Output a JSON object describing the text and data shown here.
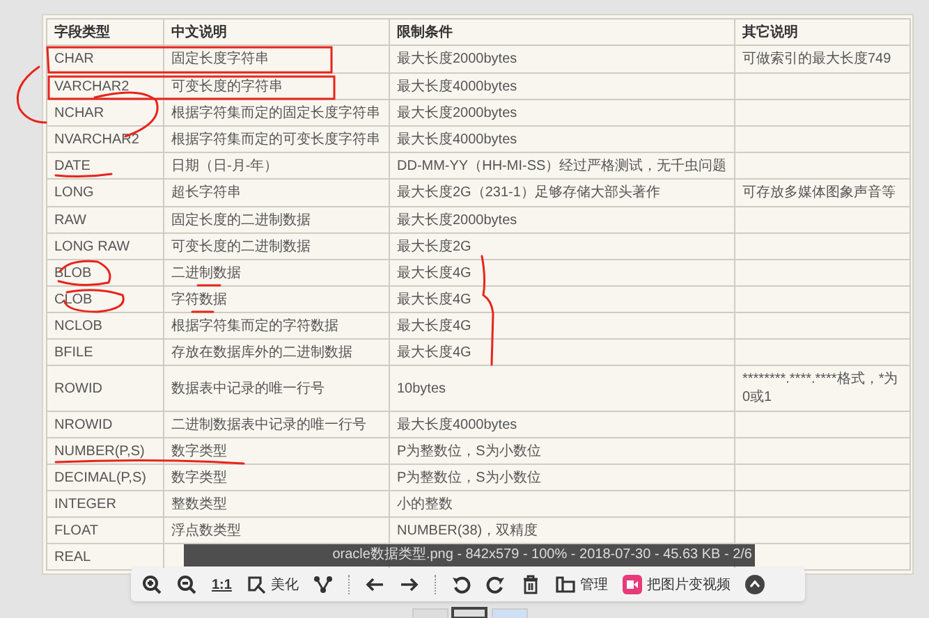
{
  "table": {
    "columns": [
      "字段类型",
      "中文说明",
      "限制条件",
      "其它说明"
    ],
    "rows": [
      {
        "field_type": "CHAR",
        "description": "固定长度字符串",
        "constraint": "最大长度2000bytes",
        "note": "可做索引的最大长度749"
      },
      {
        "field_type": "VARCHAR2",
        "description": "可变长度的字符串",
        "constraint": "最大长度4000bytes"
      },
      {
        "field_type": "NCHAR",
        "description": "根据字符集而定的固定长度字符串",
        "constraint": "最大长度2000bytes"
      },
      {
        "field_type": "NVARCHAR2",
        "description": "根据字符集而定的可变长度字符串",
        "constraint": "最大长度4000bytes"
      },
      {
        "field_type": "DATE",
        "description": "日期（日-月-年）",
        "constraint": "DD-MM-YY（HH-MI-SS）经过严格测试，无千虫问题"
      },
      {
        "field_type": "LONG",
        "description": "超长字符串",
        "constraint": "最大长度2G（231-1）足够存储大部头著作",
        "note": "可存放多媒体图象声音等"
      },
      {
        "field_type": "RAW",
        "description": "固定长度的二进制数据",
        "constraint": "最大长度2000bytes"
      },
      {
        "field_type": "LONG RAW",
        "description": "可变长度的二进制数据",
        "constraint": "最大长度2G"
      },
      {
        "field_type": "BLOB",
        "description": "二进制数据",
        "constraint": "最大长度4G"
      },
      {
        "field_type": "CLOB",
        "description": "字符数据",
        "constraint": "最大长度4G"
      },
      {
        "field_type": "NCLOB",
        "description": "根据字符集而定的字符数据",
        "constraint": "最大长度4G"
      },
      {
        "field_type": "BFILE",
        "description": "存放在数据库外的二进制数据",
        "constraint": "最大长度4G"
      },
      {
        "field_type": "ROWID",
        "description": "数据表中记录的唯一行号",
        "constraint": "10bytes",
        "note": "********.****.****格式，*为0或1"
      },
      {
        "field_type": "NROWID",
        "description": "二进制数据表中记录的唯一行号",
        "constraint": "最大长度4000bytes"
      },
      {
        "field_type": "NUMBER(P,S)",
        "description": "数字类型",
        "constraint": "P为整数位，S为小数位"
      },
      {
        "field_type": "DECIMAL(P,S)",
        "description": "数字类型",
        "constraint": "P为整数位，S为小数位"
      },
      {
        "field_type": "INTEGER",
        "description": "整数类型",
        "constraint": "小的整数"
      },
      {
        "field_type": "FLOAT",
        "description": "浮点数类型",
        "constraint": "NUMBER(38)，双精度"
      },
      {
        "field_type": "REAL"
      }
    ]
  },
  "caption": "oracle数据类型.png - 842x579 - 100% - 2018-07-30 - 45.63 KB - 2/6",
  "toolbar": [
    {
      "kind": "icon"
    },
    {
      "kind": "icon"
    },
    {
      "kind": "text",
      "label": "1:1"
    },
    {
      "kind": "icon_text",
      "label": "美化"
    },
    {
      "kind": "icon"
    },
    {
      "kind": "separator"
    },
    {
      "kind": "icon"
    },
    {
      "kind": "icon"
    },
    {
      "kind": "separator"
    },
    {
      "kind": "icon"
    },
    {
      "kind": "icon"
    },
    {
      "kind": "icon"
    },
    {
      "kind": "icon_text",
      "label": "管理"
    },
    {
      "kind": "icon_text",
      "label": "把图片变视频"
    },
    {
      "kind": "icon"
    }
  ]
}
